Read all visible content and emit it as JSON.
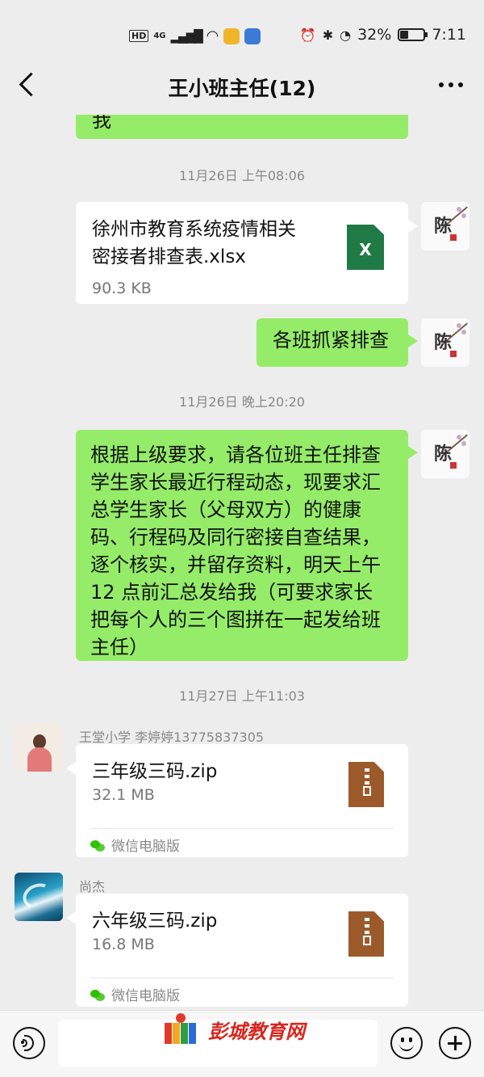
{
  "status_bar": {
    "network_left": "HD",
    "network_type": "4G",
    "battery_percent": 32,
    "battery_text": "32%",
    "time": "7:11"
  },
  "nav": {
    "title": "王小班主任(12)"
  },
  "messages": {
    "partial_top": "我",
    "ts1": "11月26日 上午08:06",
    "file1": {
      "name_line1": "徐州市教育系统疫情相关",
      "name_line2": "密接者排查表.xlsx",
      "size": "90.3 KB",
      "icon_text": "X"
    },
    "text1": "各班抓紧排查",
    "ts2": "11月26日 晚上20:20",
    "text2_lines": [
      "根据上级要求，请各位班主任排查",
      "学生家长最近行程动态，现要求汇",
      "总学生家长（父母双方）的健康",
      "码、行程码及同行密接自查结果，",
      "逐个核实，并留存资料，明天上午",
      "12 点前汇总发给我（可要求家长",
      "把每个人的三个图拼在一起发给班",
      "主任）"
    ],
    "ts3": "11月27日 上午11:03",
    "sender1": "王堂小学 李婷婷13775837305",
    "file2": {
      "name": "三年级三码.zip",
      "size": "32.1 MB",
      "source": "微信电脑版"
    },
    "sender2": "尚杰",
    "file3": {
      "name": "六年级三码.zip",
      "size": "16.8 MB",
      "source": "微信电脑版"
    },
    "avatar_chen_glyph": "陈"
  },
  "watermark": {
    "text": "彭城教育网"
  },
  "colors": {
    "green_bubble": "#95ec69",
    "background": "#ededed",
    "xlsx": "#1f7a45",
    "zip": "#9c5a2b",
    "watermark": "#d9251d"
  }
}
